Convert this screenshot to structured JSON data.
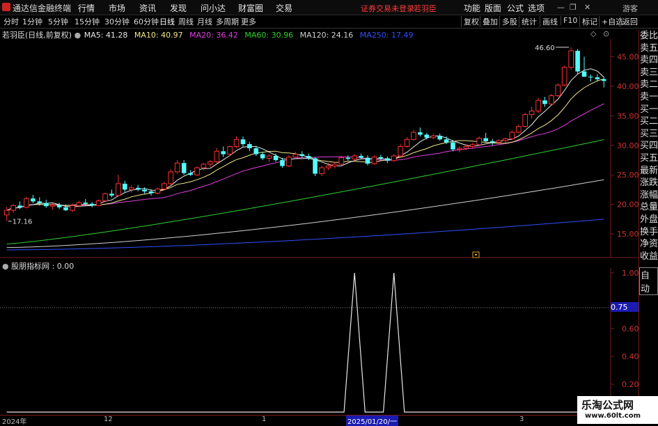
{
  "app": {
    "title": "通达信金融终端",
    "login_status": "证券交易未登录",
    "stock_name_short": "若羽臣"
  },
  "menu": [
    "行情",
    "市场",
    "资讯",
    "发现",
    "问小达",
    "财富圈",
    "交易"
  ],
  "right_menu": [
    "功能",
    "版面",
    "公式",
    "选项"
  ],
  "window_controls": {
    "minimize": "—",
    "restore": "❐",
    "close": "✕",
    "guest": "游客"
  },
  "period_tabs": [
    "分时",
    "1分钟",
    "5分钟",
    "15分钟",
    "30分钟",
    "60分钟",
    "日线",
    "周线",
    "月线",
    "多周期",
    "更多"
  ],
  "active_period": "日线",
  "tool_buttons": [
    "复权",
    "叠加",
    "多股",
    "统计",
    "画线",
    "F10",
    "标记",
    "+自选",
    "返回"
  ],
  "info": {
    "stock": "若羽臣(日线,前复权)",
    "ma": [
      {
        "label": "MA5: 41.28",
        "color": "#e8e8e8"
      },
      {
        "label": "MA10: 40.97",
        "color": "#f0e68c"
      },
      {
        "label": "MA20: 36.42",
        "color": "#e040e0"
      },
      {
        "label": "MA60: 30.96",
        "color": "#30d030"
      },
      {
        "label": "MA120: 24.16",
        "color": "#d0d0d0"
      },
      {
        "label": "MA250: 17.49",
        "color": "#3050ff"
      }
    ]
  },
  "price_axis": [
    "45.00",
    "40.00",
    "35.00",
    "30.00",
    "25.00",
    "20.00",
    "15.00"
  ],
  "price_annotations": {
    "high": "46.60",
    "low": "17.16"
  },
  "indicator": {
    "name": "股朋指标网",
    "value": "0.00",
    "label": "股朋指标网 : 0.00"
  },
  "indicator_axis": [
    "1.00",
    "0.75",
    "0.60",
    "0.40",
    "0.20"
  ],
  "right_panel": [
    "委比",
    "卖五",
    "卖四",
    "卖三",
    "卖二",
    "卖一",
    "买一",
    "买二",
    "买三",
    "买四",
    "买五",
    "最新",
    "涨跌",
    "涨幅",
    "总量",
    "外盘",
    "换手",
    "净资",
    "收益"
  ],
  "auto_button": "自动",
  "date_axis": [
    "2024年",
    "12",
    "1",
    "2",
    "3"
  ],
  "date_cursor": "2025/01/20/一",
  "watermark": {
    "line1": "乐淘公式网",
    "line2": "www.60lt.com"
  },
  "chart_data": {
    "type": "candlestick",
    "ylim": [
      11,
      48
    ],
    "candles": [
      [
        18.2,
        19.6,
        17.16,
        19.0
      ],
      [
        19.0,
        20.1,
        18.6,
        19.8
      ],
      [
        19.8,
        20.5,
        19.2,
        19.5
      ],
      [
        19.5,
        21.3,
        19.3,
        21.0
      ],
      [
        21.0,
        21.6,
        20.2,
        20.5
      ],
      [
        20.5,
        21.2,
        19.8,
        20.2
      ],
      [
        20.2,
        20.8,
        19.4,
        19.7
      ],
      [
        19.7,
        20.2,
        19.1,
        19.9
      ],
      [
        19.9,
        20.3,
        19.2,
        19.5
      ],
      [
        19.5,
        20.0,
        18.9,
        19.0
      ],
      [
        19.0,
        20.1,
        18.7,
        19.8
      ],
      [
        19.8,
        20.6,
        19.5,
        20.3
      ],
      [
        20.3,
        20.9,
        19.8,
        20.1
      ],
      [
        20.1,
        20.4,
        19.5,
        19.8
      ],
      [
        19.8,
        20.8,
        19.7,
        20.6
      ],
      [
        20.6,
        22.0,
        20.4,
        21.8
      ],
      [
        21.8,
        22.5,
        21.2,
        21.5
      ],
      [
        21.5,
        25.0,
        21.3,
        23.5
      ],
      [
        23.5,
        24.0,
        22.0,
        22.5
      ],
      [
        22.5,
        23.2,
        22.0,
        22.8
      ],
      [
        22.8,
        23.3,
        22.2,
        22.5
      ],
      [
        22.5,
        22.9,
        21.8,
        22.2
      ],
      [
        22.2,
        22.6,
        21.5,
        21.9
      ],
      [
        21.9,
        22.8,
        21.7,
        22.6
      ],
      [
        22.6,
        23.8,
        22.4,
        23.5
      ],
      [
        23.5,
        26.0,
        23.3,
        25.5
      ],
      [
        25.5,
        27.5,
        25.2,
        27.0
      ],
      [
        27.0,
        27.5,
        25.0,
        25.3
      ],
      [
        25.3,
        25.8,
        24.8,
        25.0
      ],
      [
        25.0,
        26.5,
        24.8,
        26.2
      ],
      [
        26.2,
        27.0,
        25.8,
        26.8
      ],
      [
        26.8,
        27.5,
        26.3,
        27.2
      ],
      [
        27.2,
        29.5,
        27.0,
        29.0
      ],
      [
        29.0,
        29.8,
        28.0,
        28.5
      ],
      [
        28.5,
        30.0,
        28.2,
        29.8
      ],
      [
        29.8,
        31.5,
        29.5,
        31.0
      ],
      [
        31.0,
        31.5,
        29.8,
        30.2
      ],
      [
        30.2,
        30.6,
        29.0,
        29.5
      ],
      [
        29.5,
        29.9,
        28.2,
        28.5
      ],
      [
        28.5,
        28.9,
        27.5,
        27.8
      ],
      [
        27.8,
        28.5,
        27.2,
        28.2
      ],
      [
        28.2,
        28.6,
        27.2,
        27.5
      ],
      [
        27.5,
        27.9,
        26.2,
        26.5
      ],
      [
        26.5,
        28.3,
        26.3,
        28.0
      ],
      [
        28.0,
        28.9,
        27.6,
        28.5
      ],
      [
        28.5,
        29.0,
        27.9,
        28.2
      ],
      [
        28.2,
        28.6,
        27.5,
        27.8
      ],
      [
        27.8,
        28.0,
        24.8,
        25.2
      ],
      [
        25.2,
        26.5,
        24.8,
        26.2
      ],
      [
        26.2,
        27.0,
        25.8,
        26.5
      ],
      [
        26.5,
        27.2,
        26.1,
        26.8
      ],
      [
        26.8,
        28.2,
        26.6,
        27.9
      ],
      [
        27.9,
        28.3,
        27.4,
        27.7
      ],
      [
        27.7,
        28.5,
        27.3,
        28.2
      ],
      [
        28.2,
        28.6,
        27.6,
        27.9
      ],
      [
        27.9,
        28.3,
        26.6,
        26.9
      ],
      [
        26.9,
        28.3,
        26.7,
        28.0
      ],
      [
        28.0,
        28.4,
        27.5,
        27.8
      ],
      [
        27.8,
        28.1,
        27.0,
        27.4
      ],
      [
        27.4,
        28.5,
        27.2,
        28.2
      ],
      [
        28.2,
        30.2,
        28.0,
        29.8
      ],
      [
        29.8,
        31.4,
        29.6,
        31.0
      ],
      [
        31.0,
        32.6,
        30.8,
        32.2
      ],
      [
        32.2,
        33.0,
        31.5,
        31.8
      ],
      [
        31.8,
        32.1,
        31.0,
        31.3
      ],
      [
        31.3,
        31.9,
        31.0,
        31.6
      ],
      [
        31.6,
        32.0,
        30.8,
        31.0
      ],
      [
        31.0,
        31.5,
        30.2,
        30.5
      ],
      [
        30.5,
        30.9,
        29.0,
        29.3
      ],
      [
        29.3,
        29.8,
        28.8,
        29.5
      ],
      [
        29.5,
        30.2,
        29.2,
        29.8
      ],
      [
        29.8,
        30.4,
        29.5,
        30.1
      ],
      [
        30.1,
        31.5,
        29.9,
        31.2
      ],
      [
        31.2,
        32.1,
        30.5,
        30.7
      ],
      [
        30.7,
        31.1,
        30.0,
        30.5
      ],
      [
        30.5,
        31.0,
        30.2,
        30.8
      ],
      [
        30.8,
        31.3,
        30.4,
        31.1
      ],
      [
        31.1,
        32.5,
        30.9,
        32.2
      ],
      [
        32.2,
        33.5,
        32.0,
        33.2
      ],
      [
        33.2,
        35.5,
        33.0,
        35.2
      ],
      [
        35.2,
        36.5,
        34.5,
        35.8
      ],
      [
        35.8,
        38.0,
        35.5,
        37.6
      ],
      [
        37.6,
        38.2,
        36.5,
        37.0
      ],
      [
        37.0,
        38.7,
        36.8,
        38.4
      ],
      [
        38.4,
        40.5,
        38.2,
        40.2
      ],
      [
        40.2,
        43.5,
        40.0,
        43.2
      ],
      [
        43.2,
        46.6,
        42.8,
        46.0
      ],
      [
        46.0,
        46.3,
        42.0,
        42.5
      ],
      [
        42.5,
        45.0,
        42.2,
        41.6
      ],
      [
        41.6,
        42.0,
        40.8,
        41.5
      ],
      [
        41.5,
        42.0,
        40.8,
        41.2
      ],
      [
        41.2,
        41.6,
        39.8,
        40.9
      ]
    ],
    "indicator_spikes": [
      53,
      59
    ]
  }
}
